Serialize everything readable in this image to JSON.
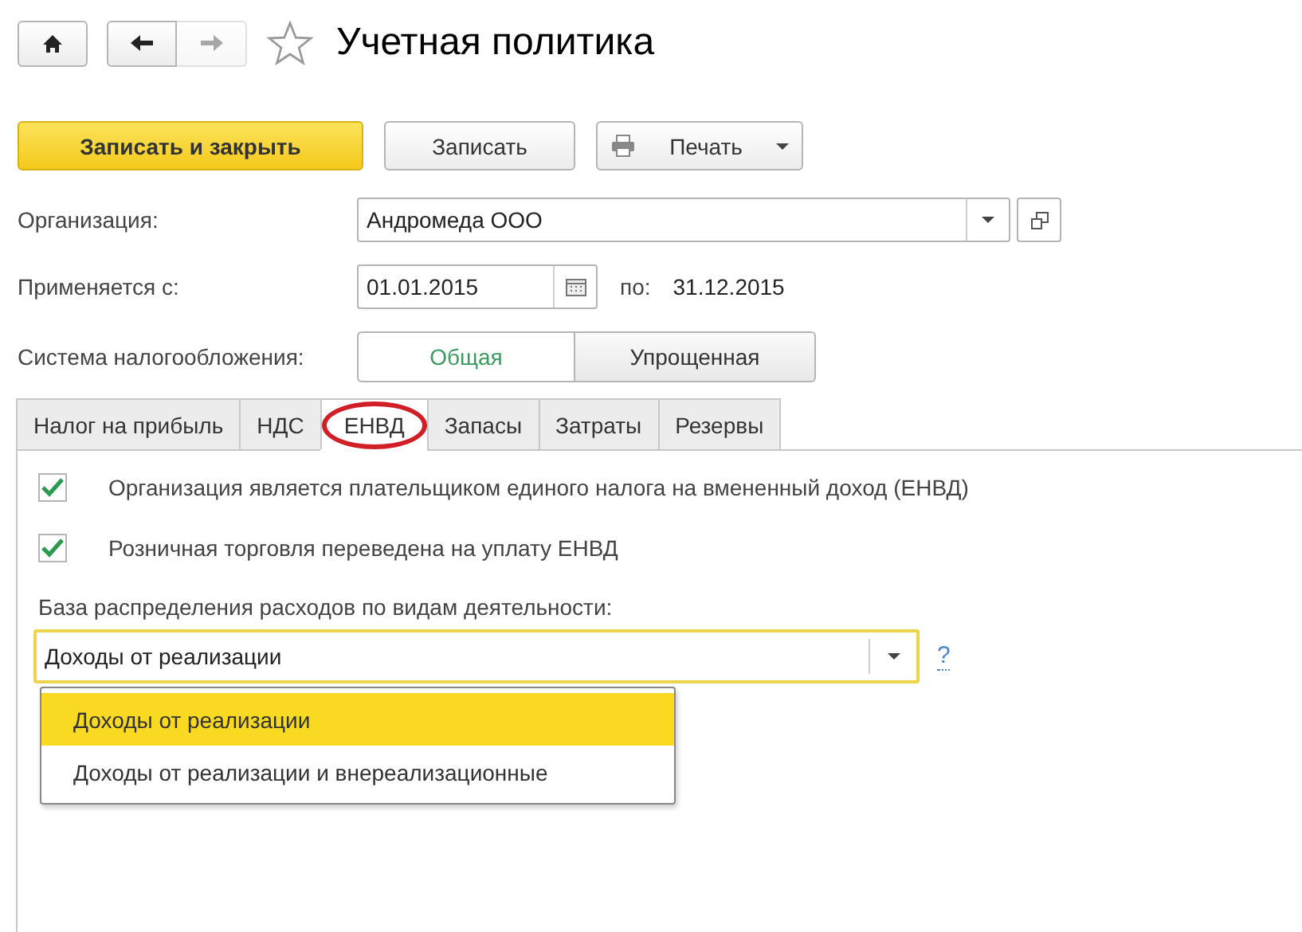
{
  "nav": [
    {
      "kind": "home",
      "disabled": false
    },
    {
      "kind": "back",
      "disabled": false
    },
    {
      "kind": "forward",
      "disabled": true
    }
  ],
  "title": "Учетная политика",
  "favorite": false,
  "toolbar": [
    {
      "kind": "primary",
      "label": "Записать и закрыть"
    },
    {
      "kind": "plain",
      "label": "Записать"
    },
    {
      "kind": "print",
      "label": "Печать"
    }
  ],
  "organization": {
    "label": "Организация:",
    "value": "Андромеда ООО"
  },
  "period": {
    "label": "Применяется с:",
    "value": "01.01.2015",
    "to_label": "по:",
    "to_value": "31.12.2015"
  },
  "tax_system": {
    "label": "Система налогообложения:",
    "options": [
      {
        "label": "Общая",
        "selected": true
      },
      {
        "label": "Упрощенная",
        "selected": false
      }
    ]
  },
  "tabs": [
    {
      "label": "Налог на прибыль",
      "selected": false,
      "circled": false
    },
    {
      "label": "НДС",
      "selected": false,
      "circled": false
    },
    {
      "label": "ЕНВД",
      "selected": true,
      "circled": true
    },
    {
      "label": "Запасы",
      "selected": false,
      "circled": false
    },
    {
      "label": "Затраты",
      "selected": false,
      "circled": false
    },
    {
      "label": "Резервы",
      "selected": false,
      "circled": false
    }
  ],
  "checkboxes": [
    {
      "label": "Организация является плательщиком единого налога на вмененный доход (ЕНВД)",
      "checked": true
    },
    {
      "label": "Розничная торговля переведена на уплату ЕНВД",
      "checked": true
    }
  ],
  "distribution_base": {
    "label": "База распределения расходов по видам деятельности:",
    "value": "Доходы от реализации",
    "help": "?",
    "options": [
      {
        "label": "Доходы от реализации",
        "selected": true
      },
      {
        "label": "Доходы от реализации и внереализационные",
        "selected": false
      }
    ]
  }
}
